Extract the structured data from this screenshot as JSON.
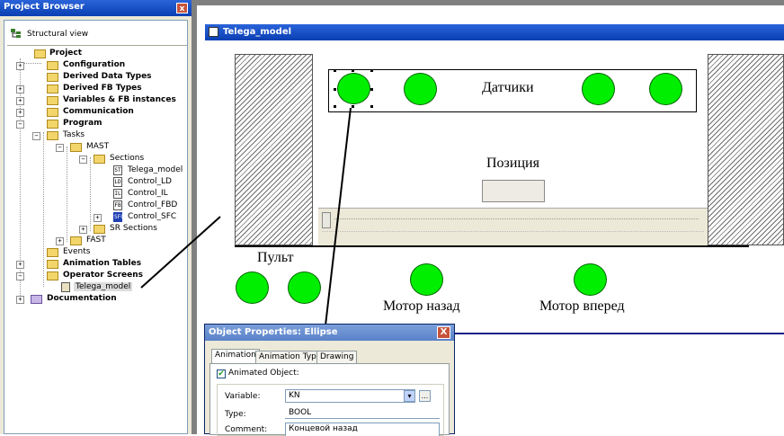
{
  "project_browser": {
    "title": "Project Browser",
    "close": "x",
    "view_label": "Structural view",
    "tree": {
      "project": "Project",
      "configuration": "Configuration",
      "derived_data_types": "Derived Data Types",
      "derived_fb_types": "Derived FB Types",
      "variables": "Variables & FB instances",
      "communication": "Communication",
      "program": "Program",
      "tasks": "Tasks",
      "mast": "MAST",
      "sections": "Sections",
      "sections_items": [
        {
          "tag": "ST",
          "label": "Telega_model"
        },
        {
          "tag": "LD",
          "label": "Control_LD"
        },
        {
          "tag": "IL",
          "label": "Control_IL"
        },
        {
          "tag": "FB",
          "label": "Control_FBD"
        },
        {
          "tag": "SFC",
          "label": "Control_SFC"
        }
      ],
      "sr_sections": "SR Sections",
      "fast": "FAST",
      "events": "Events",
      "animation_tables": "Animation Tables",
      "operator_screens": "Operator Screens",
      "telega_screen": "Telega_model",
      "documentation": "Documentation"
    }
  },
  "screen": {
    "title": "Telega_model",
    "sensors_label": "Датчики",
    "position_label": "Позиция",
    "remote_label": "Пульт",
    "motor_back_label": "Мотор назад",
    "motor_forward_label": "Мотор вперед",
    "lamp_color": "#00ee00"
  },
  "dialog": {
    "title": "Object Properties: Ellipse",
    "close": "X",
    "tabs": [
      "Animation",
      "Animation Type",
      "Drawing"
    ],
    "animated_object_label": "Animated Object:",
    "variable_label": "Variable:",
    "variable_value": "KN",
    "type_label": "Type:",
    "type_value": "BOOL",
    "comment_label": "Comment:",
    "comment_value": "Концевой назад",
    "browse_label": "..."
  }
}
